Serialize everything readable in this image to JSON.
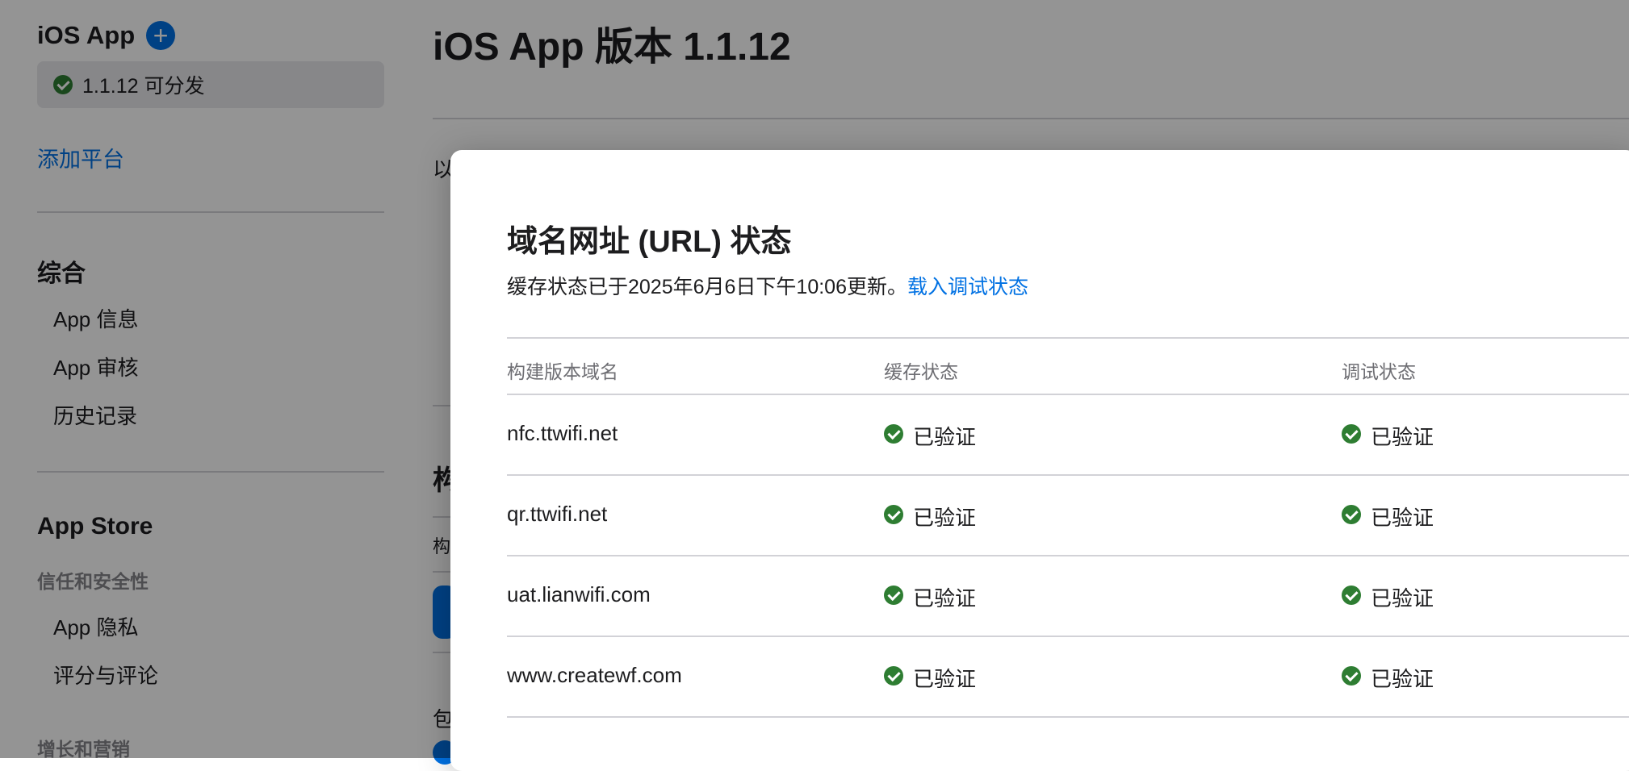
{
  "sidebar": {
    "app_title": "iOS App",
    "add_icon": "plus-circle-icon",
    "version_label": "1.1.12 可分发",
    "add_platform": "添加平台",
    "general_title": "综合",
    "general_items": [
      "App 信息",
      "App 审核",
      "历史记录"
    ],
    "store_title": "App Store",
    "trust_title": "信任和安全性",
    "trust_items": [
      "App 隐私",
      "评分与评论"
    ],
    "growth_title": "增长和营销"
  },
  "main": {
    "title": "iOS App 版本 1.1.12",
    "peek_text_1": "以",
    "peek_text_2": "构",
    "peek_text_3": "构",
    "peek_text_4": "包"
  },
  "modal": {
    "title": "域名网址 (URL) 状态",
    "subtitle": "缓存状态已于2025年6月6日下午10:06更新。",
    "load_link": "载入调试状态",
    "columns": [
      "构建版本域名",
      "缓存状态",
      "调试状态"
    ],
    "rows": [
      {
        "domain": "nfc.ttwifi.net",
        "cache": "已验证",
        "debug": "已验证"
      },
      {
        "domain": "qr.ttwifi.net",
        "cache": "已验证",
        "debug": "已验证"
      },
      {
        "domain": "uat.lianwifi.com",
        "cache": "已验证",
        "debug": "已验证"
      },
      {
        "domain": "www.createwf.com",
        "cache": "已验证",
        "debug": "已验证"
      }
    ]
  },
  "colors": {
    "accent": "#0071e3",
    "verified": "#2e7d32",
    "overlay": "rgba(0,0,0,0.42)"
  }
}
